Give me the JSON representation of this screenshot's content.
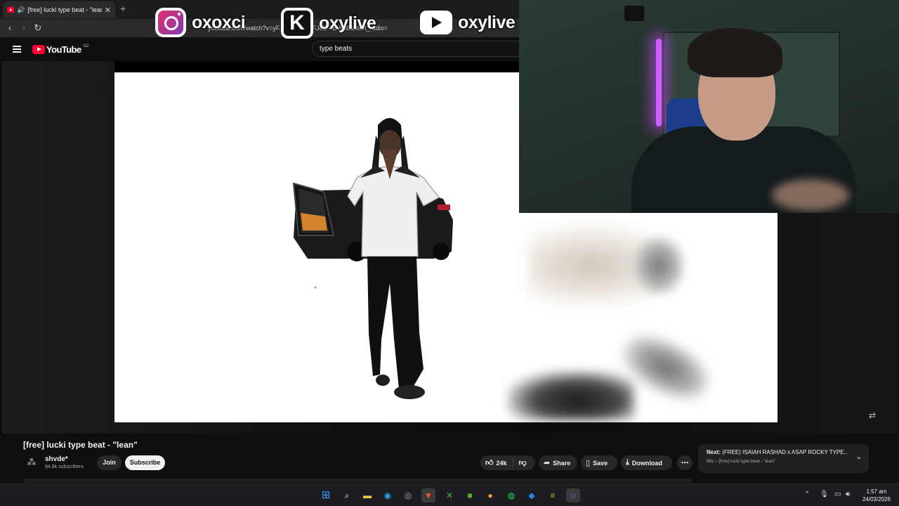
{
  "browser": {
    "tab_title": "[free] lucki type beat - \"lean\"",
    "tab_close": "✕",
    "new_tab": "+",
    "address": "youtube.com/watch?v=yF...&list=RDyFJoE-7EWd8&start_radio="
  },
  "overlay": {
    "instagram_handle": "oxoxci",
    "kick_handle": "oxylive",
    "kick_icon_letter": "K",
    "youtube_handle": "oxylive"
  },
  "youtube": {
    "logo_text": "YouTube",
    "region": "NZ",
    "search_value": "type beats"
  },
  "video": {
    "title": "[free] lucki type beat - \"lean\"",
    "channel_name": "shvde*",
    "subscribers": "84.8k subscribers",
    "join_label": "Join",
    "subscribe_label": "Subscribe",
    "likes": "24k",
    "share_label": "Share",
    "save_label": "Save",
    "download_label": "Download",
    "more_label": "⋯"
  },
  "next_up": {
    "prefix": "Next:",
    "title": "(FREE) ISAIAH RASHAD x ASAP ROCKY TYPE...",
    "subtitle": "Mix – [free] lucki type beat - \"lean\""
  },
  "taskbar": {
    "apps": [
      "windows-start",
      "search",
      "file-explorer",
      "edge",
      "chrome",
      "brave",
      "xbox",
      "minecraft",
      "fl-studio",
      "spotify",
      "roblox",
      "bluestacks",
      "discord"
    ],
    "time": "1:57 am",
    "date": "24/03/2026"
  },
  "colors": {
    "youtube_red": "#ff0033",
    "purple_light": "#d15cff",
    "pill_bg": "#272727"
  }
}
